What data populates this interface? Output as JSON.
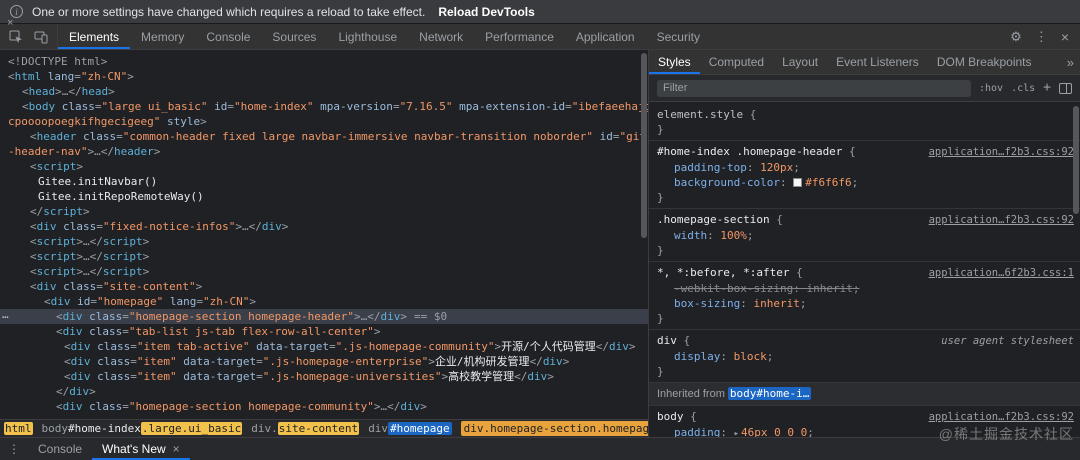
{
  "infobar": {
    "message": "One or more settings have changed which requires a reload to take effect.",
    "action_label": "Reload DevTools"
  },
  "glyphs": {
    "info": "i",
    "gear": "⚙",
    "kebab": "⋮",
    "close": "×",
    "overflow": "»",
    "ellipsis": "…"
  },
  "colors": {
    "accent": "#1a73e8",
    "search_highlight": "#f2c14b",
    "selected_crumb": "#e8a33d",
    "swatch": "#f6f6f6"
  },
  "toolbar": {
    "tabs": [
      {
        "label": "Elements",
        "active": true
      },
      {
        "label": "Memory"
      },
      {
        "label": "Console"
      },
      {
        "label": "Sources"
      },
      {
        "label": "Lighthouse"
      },
      {
        "label": "Network"
      },
      {
        "label": "Performance"
      },
      {
        "label": "Application"
      },
      {
        "label": "Security"
      }
    ]
  },
  "elements_panel": {
    "lines": [
      {
        "ind": 8,
        "tk": [
          [
            "d",
            "<!DOCTYPE html>"
          ]
        ]
      },
      {
        "ind": 8,
        "tk": [
          [
            "p",
            "<"
          ],
          [
            "t",
            "html"
          ],
          [
            "a",
            " lang"
          ],
          [
            "p",
            "="
          ],
          [
            "v",
            "\"zh-CN\""
          ],
          [
            "p",
            ">"
          ]
        ]
      },
      {
        "ind": 22,
        "tk": [
          [
            "p",
            "<"
          ],
          [
            "t",
            "head"
          ],
          [
            "p",
            ">"
          ],
          [
            "d",
            "…"
          ],
          [
            "p",
            "</"
          ],
          [
            "t",
            "head"
          ],
          [
            "p",
            ">"
          ]
        ]
      },
      {
        "ind": 22,
        "tk": [
          [
            "p",
            "<"
          ],
          [
            "t",
            "body"
          ],
          [
            "a",
            " class"
          ],
          [
            "p",
            "="
          ],
          [
            "v",
            "\"large ui_basic\""
          ],
          [
            "a",
            " id"
          ],
          [
            "p",
            "="
          ],
          [
            "v",
            "\"home-index\""
          ],
          [
            "a",
            " mpa-version"
          ],
          [
            "p",
            "="
          ],
          [
            "v",
            "\"7.16.5\""
          ],
          [
            "a",
            " mpa-extension-id"
          ],
          [
            "p",
            "="
          ],
          [
            "v",
            "\"ibefaeehajg"
          ]
        ]
      },
      {
        "ind": 8,
        "tk": [
          [
            "v",
            "cpoooopoegkifhgecigeeg\""
          ],
          [
            "a",
            " style"
          ],
          [
            "p",
            ">"
          ]
        ]
      },
      {
        "ind": 30,
        "tk": [
          [
            "p",
            "<"
          ],
          [
            "t",
            "header"
          ],
          [
            "a",
            " class"
          ],
          [
            "p",
            "="
          ],
          [
            "v",
            "\"common-header fixed large navbar-immersive navbar-transition noborder\""
          ],
          [
            "a",
            " id"
          ],
          [
            "p",
            "="
          ],
          [
            "v",
            "\"git"
          ]
        ]
      },
      {
        "ind": 8,
        "tk": [
          [
            "v",
            "-header-nav\""
          ],
          [
            "p",
            ">"
          ],
          [
            "d",
            "…"
          ],
          [
            "p",
            "</"
          ],
          [
            "t",
            "header"
          ],
          [
            "p",
            ">"
          ]
        ]
      },
      {
        "ind": 30,
        "tk": [
          [
            "p",
            "<"
          ],
          [
            "t",
            "script"
          ],
          [
            "p",
            ">"
          ]
        ]
      },
      {
        "ind": 38,
        "tk": [
          [
            "x",
            "Gitee.initNavbar()"
          ]
        ]
      },
      {
        "ind": 38,
        "tk": [
          [
            "x",
            "Gitee.initRepoRemoteWay()"
          ]
        ]
      },
      {
        "ind": 30,
        "tk": [
          [
            "p",
            "</"
          ],
          [
            "t",
            "script"
          ],
          [
            "p",
            ">"
          ]
        ]
      },
      {
        "ind": 30,
        "tk": [
          [
            "p",
            "<"
          ],
          [
            "t",
            "div"
          ],
          [
            "a",
            " class"
          ],
          [
            "p",
            "="
          ],
          [
            "v",
            "\"fixed-notice-infos\""
          ],
          [
            "p",
            ">"
          ],
          [
            "d",
            "…"
          ],
          [
            "p",
            "</"
          ],
          [
            "t",
            "div"
          ],
          [
            "p",
            ">"
          ]
        ]
      },
      {
        "ind": 30,
        "tk": [
          [
            "p",
            "<"
          ],
          [
            "t",
            "script"
          ],
          [
            "p",
            ">"
          ],
          [
            "d",
            "…"
          ],
          [
            "p",
            "</"
          ],
          [
            "t",
            "script"
          ],
          [
            "p",
            ">"
          ]
        ]
      },
      {
        "ind": 30,
        "tk": [
          [
            "p",
            "<"
          ],
          [
            "t",
            "script"
          ],
          [
            "p",
            ">"
          ],
          [
            "d",
            "…"
          ],
          [
            "p",
            "</"
          ],
          [
            "t",
            "script"
          ],
          [
            "p",
            ">"
          ]
        ]
      },
      {
        "ind": 30,
        "tk": [
          [
            "p",
            "<"
          ],
          [
            "t",
            "script"
          ],
          [
            "p",
            ">"
          ],
          [
            "d",
            "…"
          ],
          [
            "p",
            "</"
          ],
          [
            "t",
            "script"
          ],
          [
            "p",
            ">"
          ]
        ]
      },
      {
        "ind": 30,
        "tk": [
          [
            "p",
            "<"
          ],
          [
            "t",
            "div"
          ],
          [
            "a",
            " class"
          ],
          [
            "p",
            "="
          ],
          [
            "v",
            "\"site-content\""
          ],
          [
            "p",
            ">"
          ]
        ]
      },
      {
        "ind": 44,
        "tk": [
          [
            "p",
            "<"
          ],
          [
            "t",
            "div"
          ],
          [
            "a",
            " id"
          ],
          [
            "p",
            "="
          ],
          [
            "v",
            "\"homepage\""
          ],
          [
            "a",
            " lang"
          ],
          [
            "p",
            "="
          ],
          [
            "v",
            "\"zh-CN\""
          ],
          [
            "p",
            ">"
          ]
        ]
      },
      {
        "ind": 56,
        "selected": true,
        "tk": [
          [
            "p",
            "<"
          ],
          [
            "t",
            "div"
          ],
          [
            "a",
            " class"
          ],
          [
            "p",
            "="
          ],
          [
            "v",
            "\"homepage-section homepage-header\""
          ],
          [
            "p",
            ">"
          ],
          [
            "d",
            "…"
          ],
          [
            "p",
            "</"
          ],
          [
            "t",
            "div"
          ],
          [
            "p",
            ">"
          ],
          [
            "eq",
            "== $0"
          ]
        ]
      },
      {
        "ind": 56,
        "tk": [
          [
            "p",
            "<"
          ],
          [
            "t",
            "div"
          ],
          [
            "a",
            " class"
          ],
          [
            "p",
            "="
          ],
          [
            "v",
            "\"tab-list js-tab flex-row-all-center\""
          ],
          [
            "p",
            ">"
          ]
        ]
      },
      {
        "ind": 64,
        "tk": [
          [
            "p",
            "<"
          ],
          [
            "t",
            "div"
          ],
          [
            "a",
            " class"
          ],
          [
            "p",
            "="
          ],
          [
            "v",
            "\"item tab-active\""
          ],
          [
            "a",
            " data-target"
          ],
          [
            "p",
            "="
          ],
          [
            "v",
            "\".js-homepage-community\""
          ],
          [
            "p",
            ">"
          ],
          [
            "x",
            "开源/个人代码管理"
          ],
          [
            "p",
            "</"
          ],
          [
            "t",
            "div"
          ],
          [
            "p",
            ">"
          ]
        ]
      },
      {
        "ind": 64,
        "tk": [
          [
            "p",
            "<"
          ],
          [
            "t",
            "div"
          ],
          [
            "a",
            " class"
          ],
          [
            "p",
            "="
          ],
          [
            "v",
            "\"item\""
          ],
          [
            "a",
            " data-target"
          ],
          [
            "p",
            "="
          ],
          [
            "v",
            "\".js-homepage-enterprise\""
          ],
          [
            "p",
            ">"
          ],
          [
            "x",
            "企业/机构研发管理"
          ],
          [
            "p",
            "</"
          ],
          [
            "t",
            "div"
          ],
          [
            "p",
            ">"
          ]
        ]
      },
      {
        "ind": 64,
        "tk": [
          [
            "p",
            "<"
          ],
          [
            "t",
            "div"
          ],
          [
            "a",
            " class"
          ],
          [
            "p",
            "="
          ],
          [
            "v",
            "\"item\""
          ],
          [
            "a",
            " data-target"
          ],
          [
            "p",
            "="
          ],
          [
            "v",
            "\".js-homepage-universities\""
          ],
          [
            "p",
            ">"
          ],
          [
            "x",
            "高校教学管理"
          ],
          [
            "p",
            "</"
          ],
          [
            "t",
            "div"
          ],
          [
            "p",
            ">"
          ]
        ]
      },
      {
        "ind": 56,
        "tk": [
          [
            "p",
            "</"
          ],
          [
            "t",
            "div"
          ],
          [
            "p",
            ">"
          ]
        ]
      },
      {
        "ind": 56,
        "tk": [
          [
            "p",
            "<"
          ],
          [
            "t",
            "div"
          ],
          [
            "a",
            " class"
          ],
          [
            "p",
            "="
          ],
          [
            "v",
            "\"homepage-section homepage-community\""
          ],
          [
            "p",
            ">"
          ],
          [
            "d",
            "…"
          ],
          [
            "p",
            "</"
          ],
          [
            "t",
            "div"
          ],
          [
            "p",
            ">"
          ]
        ]
      }
    ]
  },
  "breadcrumbs": [
    {
      "segs": [
        [
          "html",
          "hl"
        ]
      ]
    },
    {
      "segs": [
        [
          "body",
          "p"
        ],
        [
          "#home-index",
          "bright"
        ],
        [
          ".large.ui_basic",
          "hl"
        ]
      ]
    },
    {
      "segs": [
        [
          "div.",
          "p"
        ],
        [
          "site-content",
          "hl"
        ]
      ]
    },
    {
      "segs": [
        [
          "div",
          "p"
        ],
        [
          "#homepage",
          "bluehl"
        ]
      ]
    },
    {
      "segs": [
        [
          "div.homepage-section.homepage-header",
          "selhl"
        ]
      ]
    }
  ],
  "styles_panel": {
    "tabs": [
      {
        "label": "Styles",
        "active": true
      },
      {
        "label": "Computed"
      },
      {
        "label": "Layout"
      },
      {
        "label": "Event Listeners"
      },
      {
        "label": "DOM Breakpoints"
      }
    ],
    "overflow_label": "»",
    "filter_placeholder": "Filter",
    "controls": {
      "hov": ":hov",
      "cls": ".cls",
      "plus": "+"
    },
    "rules": [
      {
        "type": "rule",
        "selector": "element.style",
        "elstyle": true,
        "link": null,
        "decls": []
      },
      {
        "type": "rule",
        "selector": "#home-index .homepage-header",
        "link": "application…f2b3.css:92",
        "decls": [
          {
            "name": "padding-top",
            "value": "120px"
          },
          {
            "name": "background-color",
            "value": "#f6f6f6",
            "swatch": "#f6f6f6"
          }
        ]
      },
      {
        "type": "rule",
        "selector": ".homepage-section",
        "link": "application…f2b3.css:92",
        "decls": [
          {
            "name": "width",
            "value": "100%"
          }
        ]
      },
      {
        "type": "rule",
        "selector": "*, *:before, *:after",
        "link": "application…6f2b3.css:1",
        "decls": [
          {
            "name": "-webkit-box-sizing",
            "value": "inherit",
            "struck": true
          },
          {
            "name": "box-sizing",
            "value": "inherit"
          }
        ]
      },
      {
        "type": "rule",
        "selector": "div",
        "link": "user agent stylesheet",
        "ua": true,
        "decls": [
          {
            "name": "display",
            "value": "block"
          }
        ]
      },
      {
        "type": "inherited",
        "label": "Inherited from ",
        "link": "body#home-i…"
      },
      {
        "type": "rule",
        "selector": "body",
        "link": "application…f2b3.css:92",
        "decls": [
          {
            "name": "padding",
            "value": "46px 0 0 0",
            "arrow": true
          }
        ]
      }
    ]
  },
  "drawer": {
    "tabs": [
      {
        "label": "Console"
      },
      {
        "label": "What's New",
        "active": true,
        "closable": true
      }
    ]
  },
  "watermark": "@稀土掘金技术社区"
}
